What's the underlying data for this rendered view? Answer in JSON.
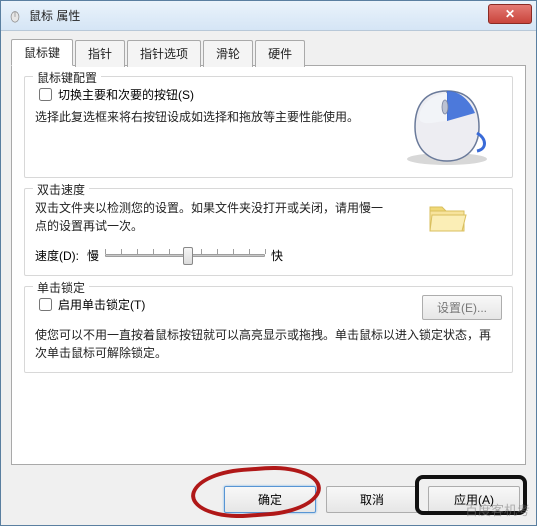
{
  "window": {
    "title": "鼠标 属性",
    "close_glyph": "✕"
  },
  "tabs": [
    {
      "label": "鼠标键",
      "active": true
    },
    {
      "label": "指针",
      "active": false
    },
    {
      "label": "指针选项",
      "active": false
    },
    {
      "label": "滑轮",
      "active": false
    },
    {
      "label": "硬件",
      "active": false
    }
  ],
  "group_buttons": {
    "legend": "鼠标键配置",
    "checkbox_label": "切换主要和次要的按钮(S)",
    "checked": false,
    "desc": "选择此复选框来将右按钮设成如选择和拖放等主要性能使用。"
  },
  "group_doubleclick": {
    "legend": "双击速度",
    "desc": "双击文件夹以检测您的设置。如果文件夹没打开或关闭，请用慢一点的设置再试一次。",
    "speed_label": "速度(D):",
    "slow_label": "慢",
    "fast_label": "快",
    "slider_value": 5,
    "slider_max": 10
  },
  "group_clicklock": {
    "legend": "单击锁定",
    "checkbox_label": "启用单击锁定(T)",
    "checked": false,
    "settings_btn": "设置(E)...",
    "desc": "使您可以不用一直按着鼠标按钮就可以高亮显示或拖拽。单击鼠标以进入锁定状态，再次单击鼠标可解除锁定。"
  },
  "footer": {
    "ok": "确定",
    "cancel": "取消",
    "apply": "应用(A)"
  },
  "watermark": "百度客机考"
}
